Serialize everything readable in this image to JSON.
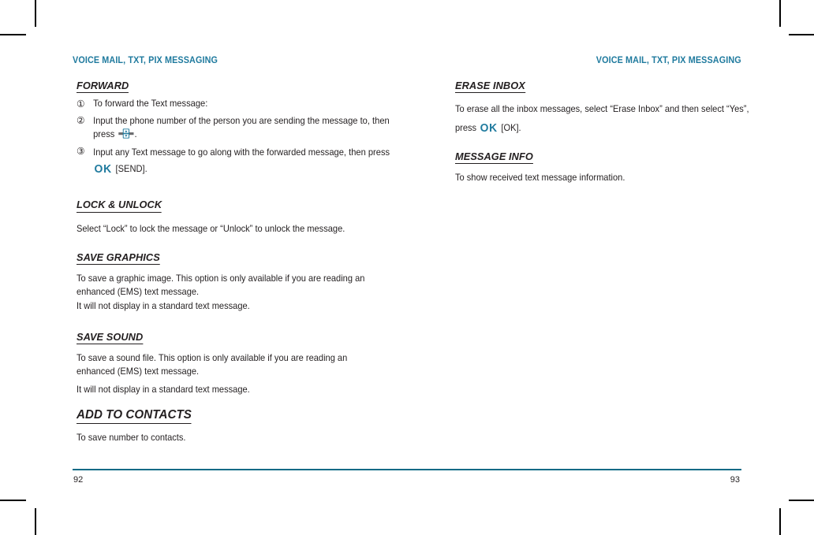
{
  "document": {
    "running_head_left": "VOICE MAIL, TXT, PIX MESSAGING",
    "running_head_right": "VOICE MAIL, TXT, PIX MESSAGING",
    "page_number_left": "92",
    "page_number_right": "93",
    "accent_color": "#1f7a9e",
    "rule_color": "#0d6a86",
    "text_color": "#231f20"
  },
  "left_column": {
    "sections": [
      {
        "heading": "FORWARD",
        "steps": [
          {
            "marker": "①",
            "text": "To forward the Text message:"
          },
          {
            "marker": "②",
            "text_before": "Input the phone number of the person you are sending the message to, then press ",
            "key_icon": "navigation-key-icon",
            "text_after": "."
          },
          {
            "marker": "③",
            "text_before": "Input any Text message to go along with the forwarded message, then press ",
            "key_label": "OK",
            "text_after": " [SEND]."
          }
        ]
      },
      {
        "heading": "LOCK & UNLOCK",
        "paragraphs": [
          "Select “Lock” to lock the message or “Unlock” to unlock the message."
        ]
      },
      {
        "heading": "SAVE GRAPHICS",
        "paragraphs": [
          "To save a graphic image. This option is only available if you are reading an enhanced (EMS) text message.",
          "It will not display in a standard text message."
        ]
      },
      {
        "heading": "SAVE SOUND",
        "paragraphs": [
          "To save a sound file. This option is only available if you are reading an enhanced (EMS) text message.",
          "It will not display in a standard text message."
        ]
      },
      {
        "heading": "ADD TO CONTACTS",
        "paragraphs": [
          "To save number to contacts."
        ]
      }
    ]
  },
  "right_column": {
    "sections": [
      {
        "heading": "ERASE INBOX",
        "text_before": "To erase all the inbox messages, select “Erase Inbox” and then select “Yes”, press ",
        "key_label": "OK",
        "text_after": " [OK]."
      },
      {
        "heading": "MESSAGE INFO",
        "paragraphs": [
          "To show received text message information."
        ]
      }
    ]
  }
}
